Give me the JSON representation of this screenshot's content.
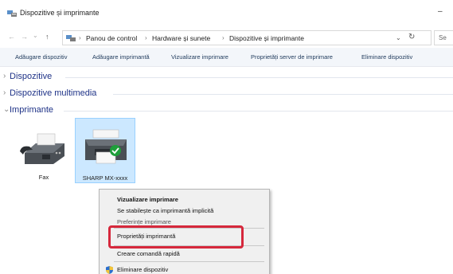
{
  "window": {
    "title": "Dispozitive și imprimante",
    "minimize_glyph": "–"
  },
  "address": {
    "back_glyph": "←",
    "forward_glyph": "→",
    "history_glyph": "⌄",
    "up_glyph": "↑",
    "crumbs": [
      "Panou de control",
      "Hardware și sunete",
      "Dispozitive și imprimante"
    ],
    "separator": "›",
    "dropdown_glyph": "⌄",
    "refresh_glyph": "↻",
    "search_placeholder": "Se"
  },
  "commands": [
    "Adăugare dispozitiv",
    "Adăugare imprimantă",
    "Vizualizare imprimare",
    "Proprietăți server de imprimare",
    "Eliminare dispozitiv"
  ],
  "groups": [
    {
      "label": "Dispozitive",
      "chevron": "›"
    },
    {
      "label": "Dispozitive multimedia",
      "chevron": "›"
    },
    {
      "label": "Imprimante",
      "chevron": "⌄"
    }
  ],
  "devices": [
    {
      "label": "Fax",
      "icon": "fax-icon"
    },
    {
      "label": "SHARP MX-xxxx",
      "icon": "printer-icon"
    }
  ],
  "context_menu": {
    "items": [
      "Vizualizare imprimare",
      "Se stabilește ca imprimantă implicită",
      "Preferințe imprimare",
      "Proprietăți imprimantă",
      "Creare comandă rapidă",
      "Eliminare dispozitiv"
    ],
    "highlighted_item": "Proprietăți imprimantă"
  },
  "colors": {
    "highlight_border": "#d6283c",
    "selection_fill": "#cce8ff",
    "group_label": "#1e3287",
    "command_text": "#1e395b"
  }
}
